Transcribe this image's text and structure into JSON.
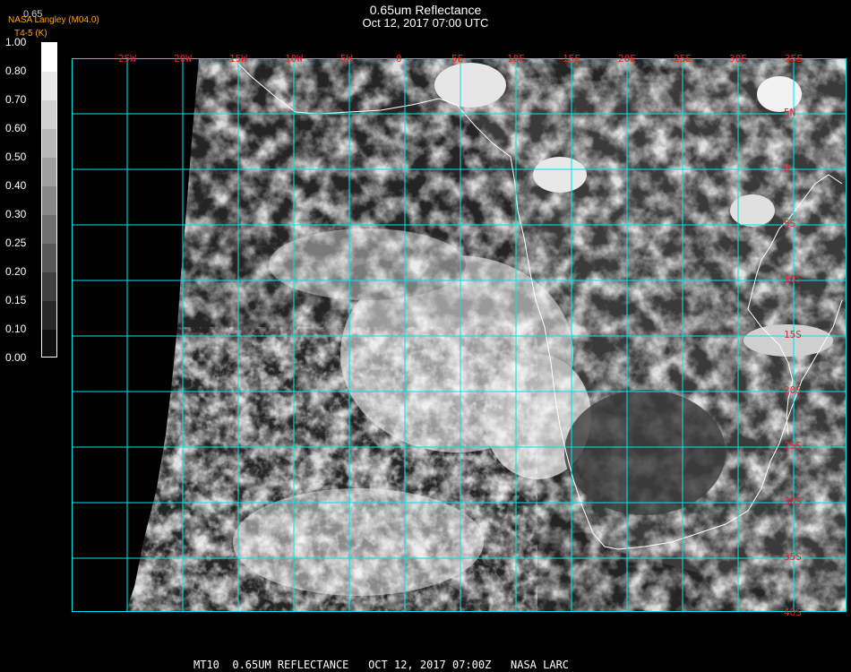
{
  "header": {
    "title": "0.65um Reflectance",
    "datetime": "Oct 12, 2017 07:00 UTC",
    "credit": "NASA Langley (M04.0)",
    "subtitle": "T4-5 (K)",
    "ghost_value": "0.65"
  },
  "colorbar": {
    "labels": [
      "1.00",
      "0.80",
      "0.70",
      "0.60",
      "0.50",
      "0.40",
      "0.30",
      "0.25",
      "0.20",
      "0.15",
      "0.10",
      "0.00"
    ]
  },
  "grid": {
    "lon_labels": [
      "25W",
      "20W",
      "15W",
      "10W",
      "5W",
      "0",
      "5E",
      "10E",
      "15E",
      "20E",
      "25E",
      "30E",
      "35E"
    ],
    "lat_labels": [
      "5N",
      "0",
      "5S",
      "10S",
      "15S",
      "20S",
      "25S",
      "30S",
      "35S",
      "40S"
    ]
  },
  "footer": {
    "text": "MT10  0.65UM REFLECTANCE   OCT 12, 2017 07:00Z   NASA LARC"
  },
  "colors": {
    "grid": "#00e5e5",
    "labels": "#e3262a",
    "coast": "#ffffff",
    "credit": "#ffa500"
  }
}
